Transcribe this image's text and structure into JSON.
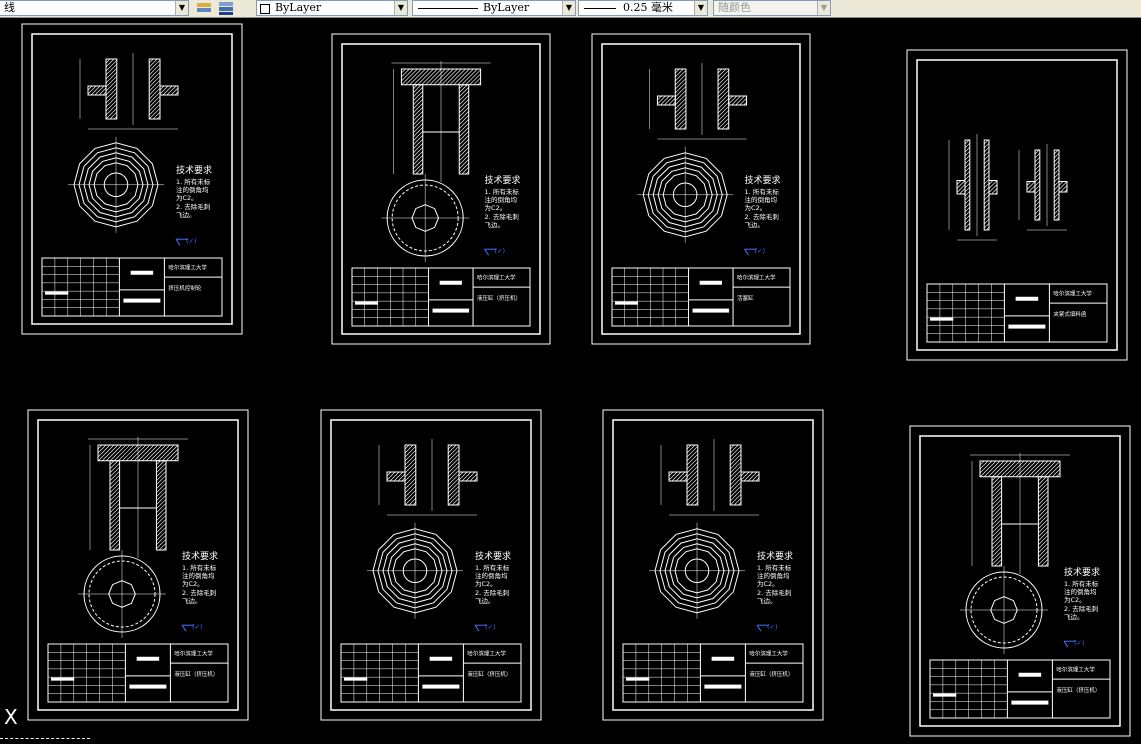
{
  "toolbar": {
    "linetype_fragment": "线",
    "color_select": "ByLayer",
    "linetype_select": "ByLayer",
    "lineweight_select": "0.25 毫米",
    "plotstyle_select": "随颜色"
  },
  "drawing_notes": {
    "tech_title": "技术要求",
    "note_1a": "1. 所有未标",
    "note_1b": "注的倒角均",
    "note_1c": "为C2。",
    "note_2a": "2. 去除毛刺",
    "note_2b": "飞边。",
    "roughness": "(✓)",
    "school": "哈尔滨理工大学"
  },
  "sheets": [
    {
      "name": "sheet-1",
      "part": "挤压机控制轮",
      "has_notes": true
    },
    {
      "name": "sheet-2",
      "part": "液压缸（挤压机）",
      "has_notes": true
    },
    {
      "name": "sheet-3",
      "part": "活塞缸",
      "has_notes": true
    },
    {
      "name": "sheet-4",
      "part": "夹紧式填料函",
      "has_notes": false
    },
    {
      "name": "sheet-5",
      "part": "液压缸（挤压机）",
      "has_notes": true
    },
    {
      "name": "sheet-6",
      "part": "液压缸（挤压机）",
      "has_notes": true
    },
    {
      "name": "sheet-7",
      "part": "液压缸（挤压机）",
      "has_notes": true
    },
    {
      "name": "sheet-8",
      "part": "液压缸（挤压机）",
      "has_notes": true
    }
  ],
  "status": {
    "ucs_label": "X"
  }
}
